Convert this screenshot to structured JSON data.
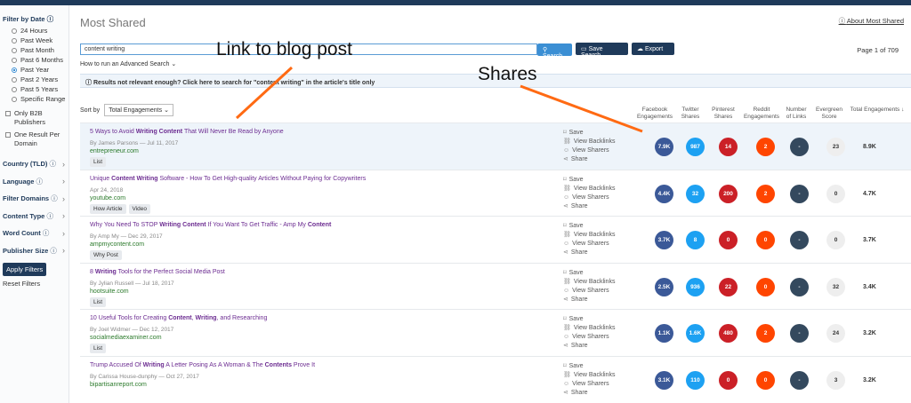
{
  "sidebar": {
    "filter_by_date": "Filter by Date",
    "date_options": [
      "24 Hours",
      "Past Week",
      "Past Month",
      "Past 6 Months",
      "Past Year",
      "Past 2 Years",
      "Past 5 Years",
      "Specific Range"
    ],
    "selected_date": "Past Year",
    "checkboxes": [
      "Only B2B Publishers",
      "One Result Per Domain"
    ],
    "filters": [
      "Country (TLD)",
      "Language",
      "Filter Domains",
      "Content Type",
      "Word Count",
      "Publisher Size"
    ],
    "apply_label": "Apply Filters",
    "reset_label": "Reset Filters"
  },
  "header": {
    "title": "Most Shared",
    "about_label": "About Most Shared"
  },
  "search": {
    "value": "content writing",
    "search_label": "Search",
    "save_search_label": "Save Search",
    "export_label": "Export",
    "advanced_label": "How to run an Advanced Search",
    "page_info": "Page 1 of 709"
  },
  "notice": {
    "text": "Results not relevant enough? Click here to search for \"content writing\" in the article's title only"
  },
  "sort": {
    "label": "Sort by",
    "value": "Total Engagements"
  },
  "columns": {
    "facebook": "Facebook Engagements",
    "twitter": "Twitter Shares",
    "pinterest": "Pinterest Shares",
    "reddit": "Reddit Engagements",
    "links": "Number of Links",
    "evergreen": "Evergreen Score",
    "total": "Total Engagements"
  },
  "actions": {
    "save": "Save",
    "backlinks": "View Backlinks",
    "sharers": "View Sharers",
    "share": "Share"
  },
  "rows": [
    {
      "title_html": "5 Ways to Avoid <b>Writing Content</b> That Will Never Be Read by Anyone",
      "by": "By James Parsons — Jul 11, 2017",
      "url": "entrepreneur.com",
      "tags": [
        "List"
      ],
      "fb": "7.9K",
      "tw": "987",
      "pi": "14",
      "rd": "2",
      "ln": "-",
      "ev": "23",
      "total": "8.9K"
    },
    {
      "title_html": "Unique <b>Content Writing</b> Software - How To Get High-quality Articles Without Paying for Copywriters",
      "by": "Apr 24, 2018",
      "url": "youtube.com",
      "tags": [
        "How Article",
        "Video"
      ],
      "fb": "4.4K",
      "tw": "32",
      "pi": "200",
      "rd": "2",
      "ln": "-",
      "ev": "0",
      "total": "4.7K"
    },
    {
      "title_html": "Why You Need To STOP <b>Writing Content</b> If You Want To Get Traffic - Amp My <b>Content</b>",
      "by": "By Amp My — Dec 29, 2017",
      "url": "ampmycontent.com",
      "tags": [
        "Why Post"
      ],
      "fb": "3.7K",
      "tw": "8",
      "pi": "0",
      "rd": "0",
      "ln": "-",
      "ev": "0",
      "total": "3.7K"
    },
    {
      "title_html": "8 <b>Writing</b> Tools for the Perfect Social Media Post",
      "by": "By Jylian Russell — Jul 18, 2017",
      "url": "hootsuite.com",
      "tags": [
        "List"
      ],
      "fb": "2.5K",
      "tw": "936",
      "pi": "22",
      "rd": "0",
      "ln": "-",
      "ev": "32",
      "total": "3.4K"
    },
    {
      "title_html": "10 Useful Tools for Creating <b>Content</b>, <b>Writing</b>, and Researching",
      "by": "By Joel Widmer — Dec 12, 2017",
      "url": "socialmediaexaminer.com",
      "tags": [
        "List"
      ],
      "fb": "1.1K",
      "tw": "1.6K",
      "pi": "480",
      "rd": "2",
      "ln": "-",
      "ev": "24",
      "total": "3.2K"
    },
    {
      "title_html": "Trump Accused Of <b>Writing</b> A Letter Posing As A Woman &amp; The <b>Contents</b> Prove It",
      "by": "By Carissa House-dunphy — Oct 27, 2017",
      "url": "bipartisanreport.com",
      "tags": [],
      "fb": "3.1K",
      "tw": "110",
      "pi": "0",
      "rd": "0",
      "ln": "-",
      "ev": "3",
      "total": "3.2K"
    }
  ],
  "annotations": {
    "link": "Link to blog post",
    "shares": "Shares"
  },
  "colors": {
    "facebook": "#3b5998",
    "twitter": "#1da1f2",
    "pinterest": "#cb2027",
    "reddit": "#ff4500",
    "links": "#34495e",
    "accent": "#3b8fd4",
    "navy": "#1f3a5a"
  }
}
